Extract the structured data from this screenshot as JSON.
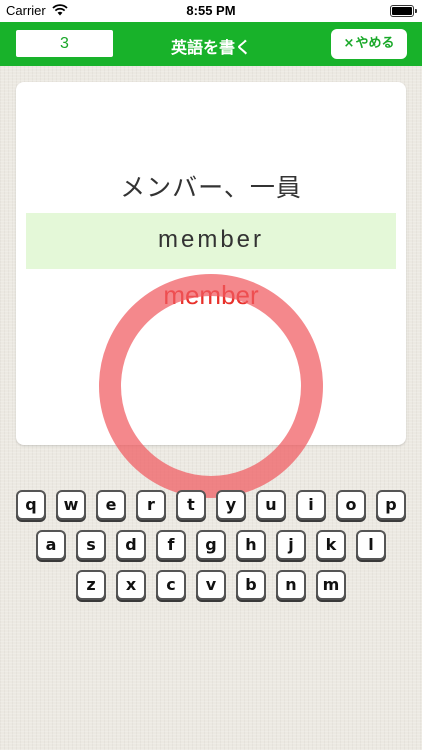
{
  "status_bar": {
    "carrier": "Carrier",
    "time": "8:55 PM"
  },
  "nav": {
    "counter": "3",
    "title": "英語を書く",
    "quit_icon": "×",
    "quit_label": "やめる"
  },
  "card": {
    "meaning": "メンバー、一員",
    "user_answer": "member",
    "correct_answer": "member"
  },
  "result": {
    "indicator": "correct-circle",
    "color": "#f05a5f"
  },
  "colors": {
    "accent": "#18b22a",
    "answer_bg": "#e4f8d8",
    "correct_text": "#e8302a"
  },
  "keyboard": {
    "row1": [
      "q",
      "w",
      "e",
      "r",
      "t",
      "y",
      "u",
      "i",
      "o",
      "p"
    ],
    "row2": [
      "a",
      "s",
      "d",
      "f",
      "g",
      "h",
      "j",
      "k",
      "l"
    ],
    "row3": [
      "z",
      "x",
      "c",
      "v",
      "b",
      "n",
      "m"
    ]
  }
}
